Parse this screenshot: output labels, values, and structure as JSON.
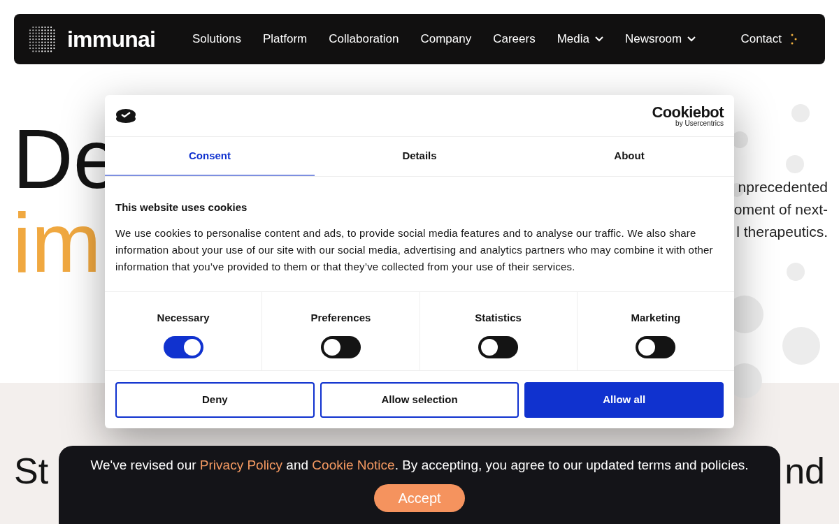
{
  "nav": {
    "brand": "immunai",
    "links": [
      {
        "label": "Solutions",
        "dropdown": false
      },
      {
        "label": "Platform",
        "dropdown": false
      },
      {
        "label": "Collaboration",
        "dropdown": false
      },
      {
        "label": "Company",
        "dropdown": false
      },
      {
        "label": "Careers",
        "dropdown": false
      },
      {
        "label": "Media",
        "dropdown": true
      },
      {
        "label": "Newsroom",
        "dropdown": true
      }
    ],
    "contact": "Contact"
  },
  "hero": {
    "title_line_1": "De",
    "title_line_2": "im",
    "text_lines": [
      "nprecedented",
      "oment of next-",
      "l therapeutics."
    ]
  },
  "section": {
    "left": "St",
    "right": "nd"
  },
  "consent": {
    "brand": "Cookiebot",
    "brand_sub": "by Usercentrics",
    "tabs": [
      {
        "label": "Consent",
        "selected": true
      },
      {
        "label": "Details",
        "selected": false
      },
      {
        "label": "About",
        "selected": false
      }
    ],
    "heading": "This website uses cookies",
    "body": "We use cookies to personalise content and ads, to provide social media features and to analyse our traffic. We also share information about your use of our site with our social media, advertising and analytics partners who may combine it with other information that you’ve provided to them or that they’ve collected from your use of their services.",
    "categories": [
      {
        "label": "Necessary",
        "on": true
      },
      {
        "label": "Preferences",
        "on": false
      },
      {
        "label": "Statistics",
        "on": false
      },
      {
        "label": "Marketing",
        "on": false
      }
    ],
    "buttons": [
      {
        "label": "Deny",
        "kind": "outline"
      },
      {
        "label": "Allow selection",
        "kind": "outline"
      },
      {
        "label": "Allow all",
        "kind": "primary"
      }
    ]
  },
  "banner": {
    "before": "We've revised our ",
    "link_1": "Privacy Policy",
    "middle": " and ",
    "link_2": "Cookie Notice",
    "after": ". By accepting, you agree to our updated terms and policies.",
    "button": "Accept"
  }
}
